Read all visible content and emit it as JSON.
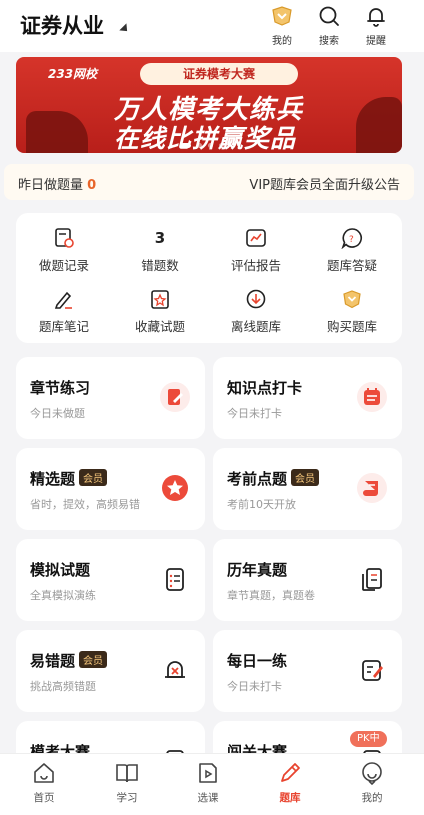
{
  "header": {
    "title": "证券从业",
    "icons": [
      {
        "name": "my-badge-icon",
        "label": "我的"
      },
      {
        "name": "search-icon",
        "label": "搜索"
      },
      {
        "name": "bell-icon",
        "label": "提醒"
      }
    ]
  },
  "banner": {
    "brand": "233网校",
    "pill": "证券模考大赛",
    "line1": "万人模考大练兵",
    "line2": "在线比拼赢奖品"
  },
  "notice": {
    "left_label": "昨日做题量",
    "left_value": "0",
    "right_text": "VIP题库会员全面升级公告"
  },
  "tools": [
    {
      "icon": "record-icon",
      "label": "做题记录"
    },
    {
      "value": "3",
      "label": "错题数"
    },
    {
      "icon": "report-icon",
      "label": "评估报告"
    },
    {
      "icon": "qa-icon",
      "label": "题库答疑"
    },
    {
      "icon": "note-icon",
      "label": "题库笔记"
    },
    {
      "icon": "favorite-icon",
      "label": "收藏试题"
    },
    {
      "icon": "download-icon",
      "label": "离线题库"
    },
    {
      "icon": "buy-icon",
      "label": "购买题库"
    }
  ],
  "cards": [
    {
      "title": "章节练习",
      "sub": "今日未做题",
      "icon": "chapter-icon"
    },
    {
      "title": "知识点打卡",
      "sub": "今日未打卡",
      "icon": "calendar-icon"
    },
    {
      "title": "精选题",
      "badge": "会员",
      "sub": "省时，提效，高频易错",
      "icon": "star-icon"
    },
    {
      "title": "考前点题",
      "badge": "会员",
      "sub": "考前10天开放",
      "icon": "scroll-icon"
    },
    {
      "title": "模拟试题",
      "sub": "全真模拟演练",
      "icon": "list-icon"
    },
    {
      "title": "历年真题",
      "sub": "章节真题，真题卷",
      "icon": "papers-icon"
    },
    {
      "title": "易错题",
      "badge": "会员",
      "sub": "挑战高频错题",
      "icon": "alarm-icon"
    },
    {
      "title": "每日一练",
      "sub": "今日未打卡",
      "icon": "edit-icon"
    },
    {
      "title": "模考大赛",
      "sub": "",
      "icon": "contest-icon"
    },
    {
      "title": "闯关大赛",
      "sub": "",
      "icon": "pk-icon"
    }
  ],
  "pk_badge": "PK中",
  "tabs": [
    {
      "label": "首页",
      "icon": "home-icon"
    },
    {
      "label": "学习",
      "icon": "book-icon"
    },
    {
      "label": "选课",
      "icon": "course-icon"
    },
    {
      "label": "题库",
      "icon": "pen-icon",
      "active": true
    },
    {
      "label": "我的",
      "icon": "profile-icon"
    }
  ],
  "colors": {
    "accent": "#e8442f",
    "highlight": "#e8652b",
    "banner": "#c9281f",
    "badge_bg": "#3b2a1a",
    "badge_text": "#f6c77c"
  }
}
